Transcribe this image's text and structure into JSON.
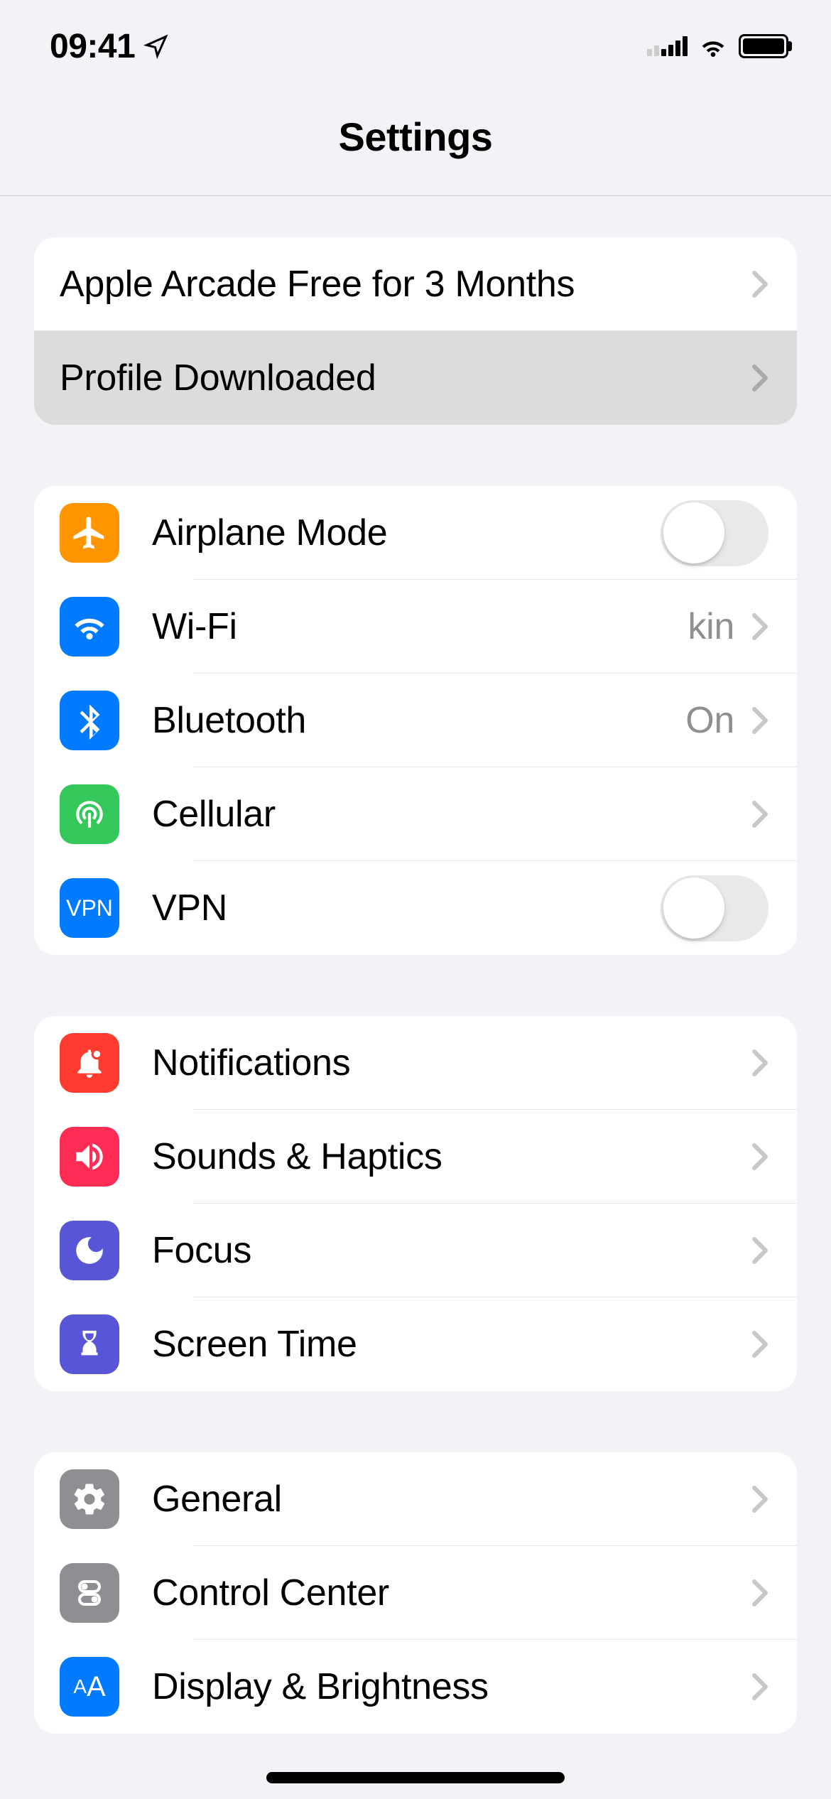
{
  "status": {
    "time": "09:41"
  },
  "header": {
    "title": "Settings"
  },
  "groups": [
    {
      "rows": [
        {
          "label": "Apple Arcade Free for 3 Months"
        },
        {
          "label": "Profile Downloaded"
        }
      ]
    },
    {
      "rows": [
        {
          "label": "Airplane Mode"
        },
        {
          "label": "Wi-Fi",
          "value": "kin"
        },
        {
          "label": "Bluetooth",
          "value": "On"
        },
        {
          "label": "Cellular"
        },
        {
          "label": "VPN"
        }
      ]
    },
    {
      "rows": [
        {
          "label": "Notifications"
        },
        {
          "label": "Sounds & Haptics"
        },
        {
          "label": "Focus"
        },
        {
          "label": "Screen Time"
        }
      ]
    },
    {
      "rows": [
        {
          "label": "General"
        },
        {
          "label": "Control Center"
        },
        {
          "label": "Display & Brightness"
        }
      ]
    }
  ],
  "vpn_text": "VPN"
}
